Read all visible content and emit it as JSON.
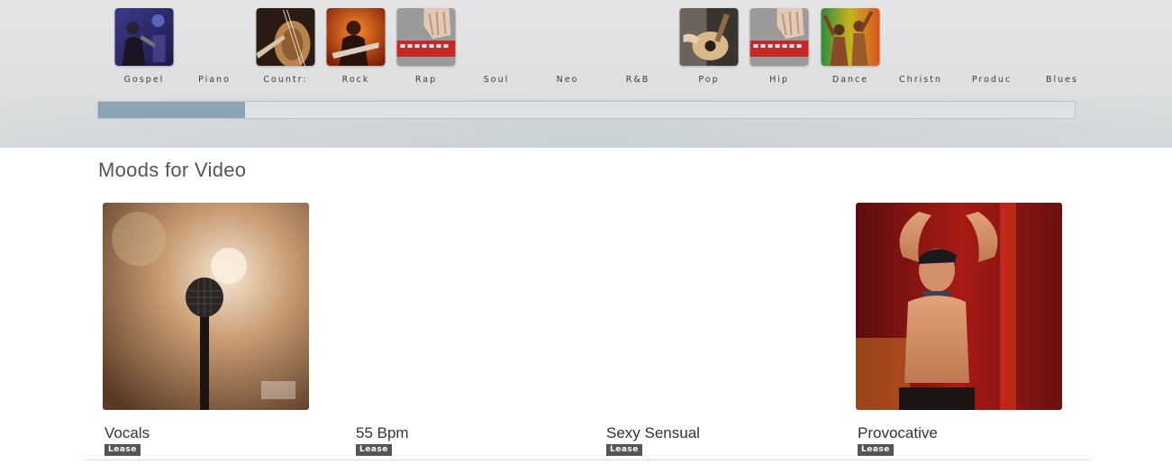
{
  "genres": [
    {
      "label": "Gospel",
      "icon": "gospel-singer-thumb"
    },
    {
      "label": "Piano",
      "icon": null
    },
    {
      "label": "Countr:",
      "icon": "cello-thumb"
    },
    {
      "label": "Rock",
      "icon": "rock-guitarist-thumb"
    },
    {
      "label": "Rap",
      "icon": "beat-machine-thumb"
    },
    {
      "label": "Soul",
      "icon": null
    },
    {
      "label": "Neo",
      "icon": null
    },
    {
      "label": "R&B",
      "icon": null
    },
    {
      "label": "Pop",
      "icon": "acoustic-guitar-thumb"
    },
    {
      "label": "Hip",
      "icon": "beat-machine-thumb"
    },
    {
      "label": "Dance",
      "icon": "dance-crowd-thumb"
    },
    {
      "label": "Christn",
      "icon": null
    },
    {
      "label": "Produc",
      "icon": null
    },
    {
      "label": "Blues",
      "icon": null
    }
  ],
  "scroll_progress": 0.15,
  "moods": {
    "title": "Moods for Video",
    "cards": [
      {
        "title": "Vocals",
        "badge": "Lease",
        "image": "microphone-image"
      },
      {
        "title": "55 Bpm",
        "badge": "Lease",
        "image": null
      },
      {
        "title": "Sexy Sensual",
        "badge": "Lease",
        "image": null
      },
      {
        "title": "Provocative",
        "badge": "Lease",
        "image": "performer-image"
      }
    ]
  },
  "colors": {
    "progress_fill": "#8aa4b6",
    "badge_bg": "#555555"
  }
}
